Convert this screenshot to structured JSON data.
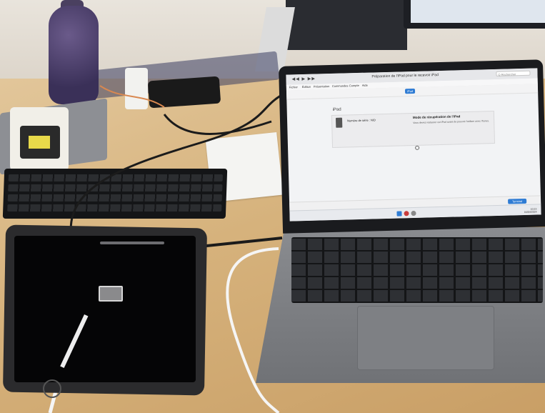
{
  "itunes": {
    "transport": "◀◀ ▶ ▶▶",
    "title": "Préparation de l'iPad pour le recevoir iPad",
    "search_placeholder": "Q  Rechercher",
    "menus": [
      "Fichier",
      "Édition",
      "Présentation",
      "Commandes",
      "Compte",
      "Aide"
    ],
    "device_pill": "iPad",
    "heading": "iPad",
    "serial_label": "Numéro de série : N/D",
    "recovery_title": "Mode de récupération de l'iPad",
    "recovery_text": "Vous devez restaurer cet iPad avant de pouvoir l'utiliser avec iTunes.",
    "done_button": "Terminé",
    "clock": "10:23",
    "date": "04/04/2024"
  },
  "colors": {
    "desk": "#d6b27c",
    "accent": "#2f7cd4"
  }
}
